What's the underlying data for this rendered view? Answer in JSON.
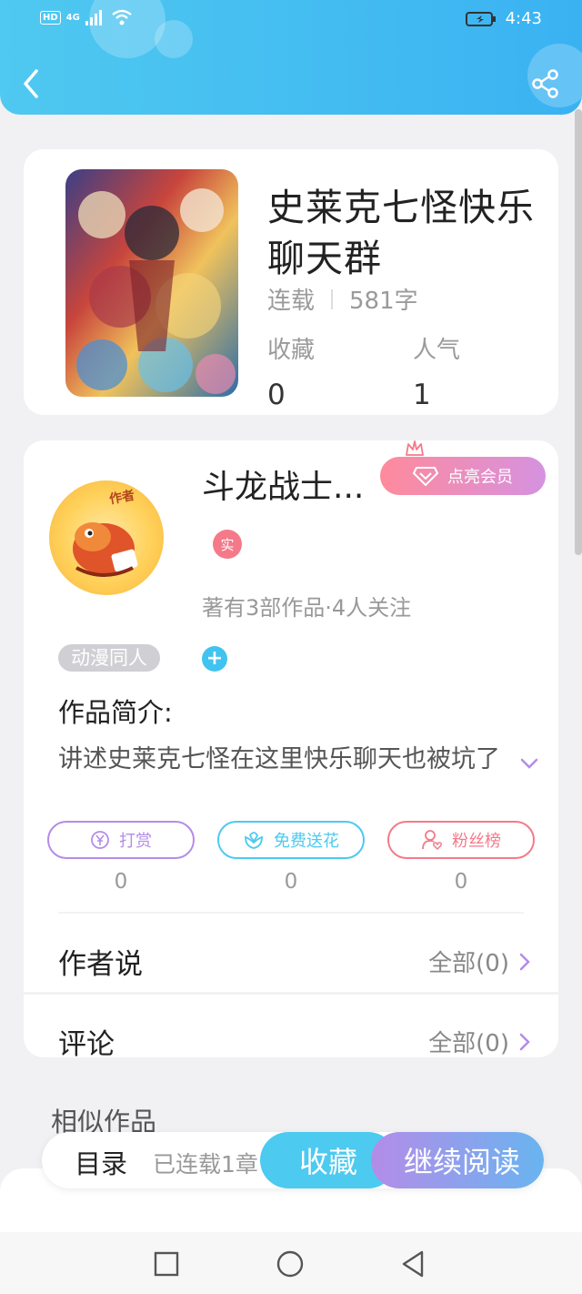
{
  "status_bar": {
    "hd": "HD",
    "network": "4G",
    "time": "4:43"
  },
  "colors": {
    "header": "#3ab2f2",
    "accent_blue": "#4ccaf0",
    "purple": "#b48ce8",
    "pink": "#f47a8a"
  },
  "book": {
    "title": "史莱克七怪快乐聊天群",
    "status": "连载",
    "word_count": "581字",
    "favorites_label": "收藏",
    "favorites_value": "0",
    "popularity_label": "人气",
    "popularity_value": "1"
  },
  "author": {
    "name": "斗龙战士...",
    "vip_label": "点亮会员",
    "verified_badge": "实",
    "info": "著有3部作品·4人关注",
    "avatar_text": "作者",
    "tag": "动漫同人",
    "tag_add": "+"
  },
  "intro": {
    "label": "作品简介:",
    "text": "讲述史莱克七怪在这里快乐聊天也被坑了"
  },
  "actions": [
    {
      "label": "打赏",
      "count": "0",
      "icon": "yen-coin-icon",
      "color": "#b48ce8"
    },
    {
      "label": "免费送花",
      "count": "0",
      "icon": "flower-icon",
      "color": "#4ccaf0"
    },
    {
      "label": "粉丝榜",
      "count": "0",
      "icon": "user-heart-icon",
      "color": "#f47a8a"
    }
  ],
  "rows": {
    "author_says": {
      "label": "作者说",
      "link": "全部(0)"
    },
    "comments": {
      "label": "评论",
      "link": "全部(0)"
    }
  },
  "similar_title": "相似作品",
  "bottom_bar": {
    "toc": "目录",
    "serial": "已连载1章",
    "favorite": "收藏",
    "continue": "继续阅读"
  }
}
